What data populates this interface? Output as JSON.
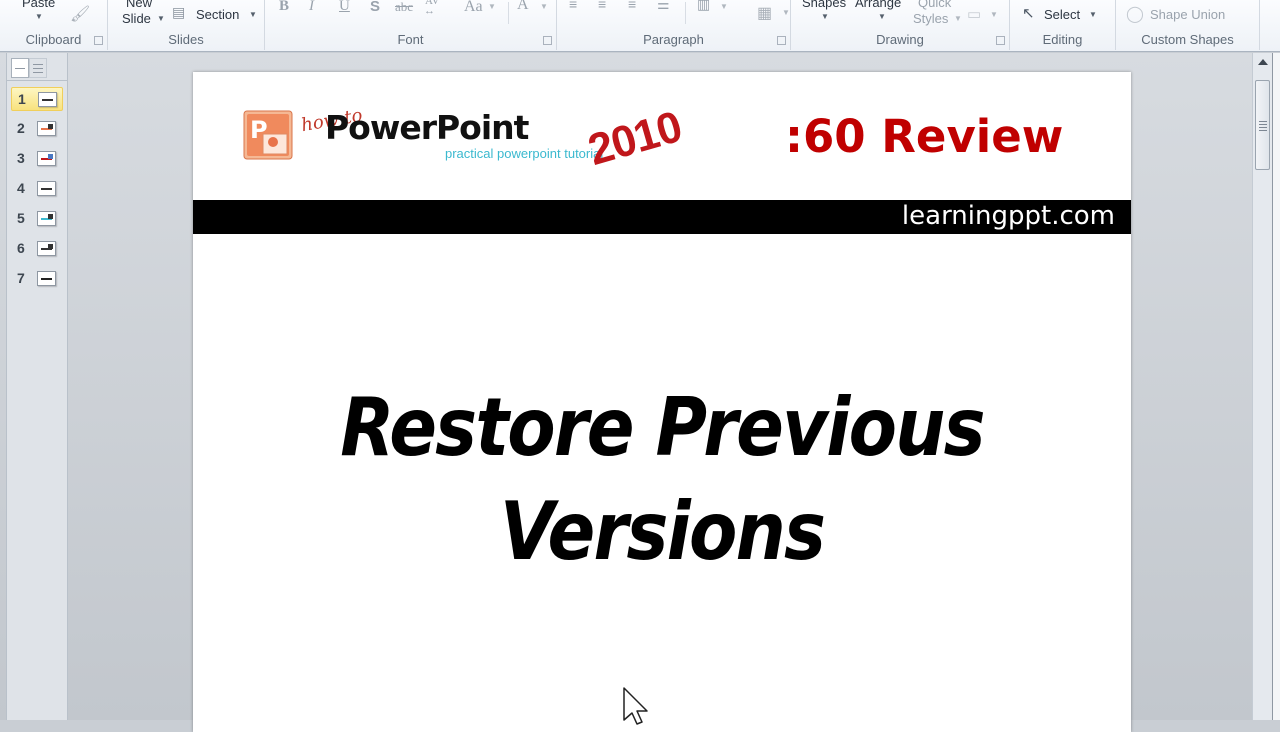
{
  "ribbon": {
    "clipboard": {
      "label": "Clipboard",
      "paste": "Paste"
    },
    "slides": {
      "label": "Slides",
      "new_slide_line1": "New",
      "new_slide_line2": "Slide",
      "section": "Section"
    },
    "font": {
      "label": "Font",
      "bold": "B",
      "italic": "I",
      "underline": "U",
      "shadow": "S",
      "strikethrough": "abc",
      "spacing": "AV",
      "change_case": "Aa",
      "font_color": "A"
    },
    "paragraph": {
      "label": "Paragraph"
    },
    "drawing": {
      "label": "Drawing",
      "shapes": "Shapes",
      "arrange": "Arrange",
      "quick_styles_line1": "Quick",
      "quick_styles_line2": "Styles"
    },
    "editing": {
      "label": "Editing",
      "select": "Select"
    },
    "custom_shapes": {
      "label": "Custom Shapes",
      "shape_union": "Shape Union"
    }
  },
  "thumbnails": [
    {
      "number": "1",
      "selected": true
    },
    {
      "number": "2",
      "selected": false
    },
    {
      "number": "3",
      "selected": false
    },
    {
      "number": "4",
      "selected": false
    },
    {
      "number": "5",
      "selected": false
    },
    {
      "number": "6",
      "selected": false
    },
    {
      "number": "7",
      "selected": false
    }
  ],
  "slide": {
    "logo_howto": "how to",
    "logo_title": "PowerPoint",
    "logo_subtitle": "practical powerpoint tutorial",
    "logo_year": "2010",
    "review_label": ":60 Review",
    "band_text": "learningppt.com",
    "title_line1": "Restore Previous",
    "title_line2": "Versions"
  },
  "colors": {
    "review_red": "#c00000",
    "year_red": "#c0171b",
    "subtitle_cyan": "#3bb9cf",
    "logo_orange": "#e8734a",
    "selected_thumb": "#f8e27e"
  }
}
